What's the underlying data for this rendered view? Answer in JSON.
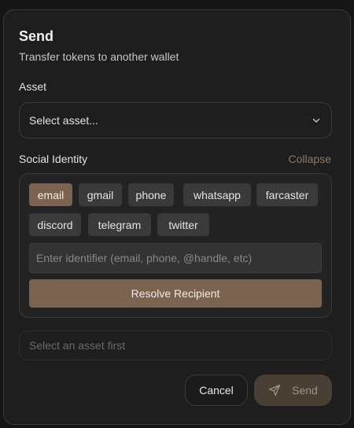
{
  "dialog": {
    "title": "Send",
    "subtitle": "Transfer tokens to another wallet"
  },
  "asset": {
    "label": "Asset",
    "selected": "Select asset...",
    "icon": "chevron-down-icon"
  },
  "social": {
    "label": "Social Identity",
    "collapse_label": "Collapse",
    "providers": [
      {
        "label": "email",
        "active": true
      },
      {
        "label": "gmail",
        "active": false
      },
      {
        "label": "phone",
        "active": false
      },
      {
        "label": "whatsapp",
        "active": false
      },
      {
        "label": "farcaster",
        "active": false
      },
      {
        "label": "discord",
        "active": false
      },
      {
        "label": "telegram",
        "active": false
      },
      {
        "label": "twitter",
        "active": false
      }
    ],
    "identifier_placeholder": "Enter identifier (email, phone, @handle, etc)",
    "resolve_label": "Resolve Recipient"
  },
  "amount": {
    "placeholder": "Select an asset first"
  },
  "actions": {
    "cancel_label": "Cancel",
    "send_label": "Send",
    "send_icon": "send-icon"
  },
  "colors": {
    "accent": "#7a6450",
    "accent_muted": "#4a3f34",
    "collapse_link": "#8a7a66",
    "background": "#1e1e1e"
  }
}
